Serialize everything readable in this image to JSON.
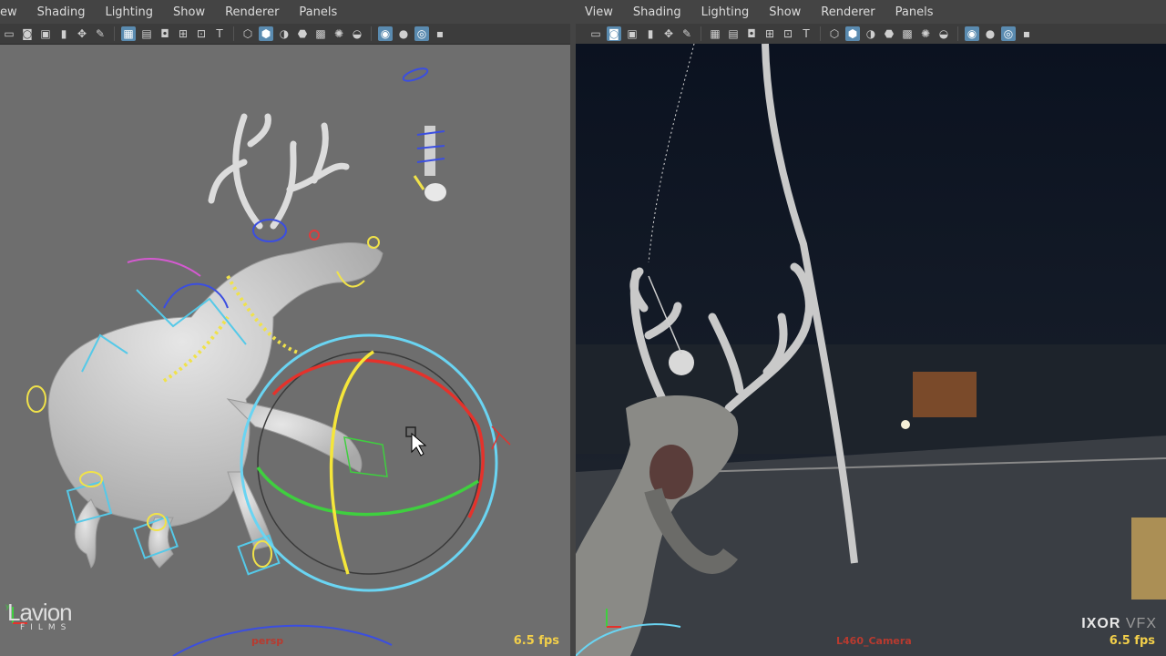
{
  "left_viewport": {
    "menu": [
      "ew",
      "Shading",
      "Lighting",
      "Show",
      "Renderer",
      "Panels"
    ],
    "camera": "persp",
    "fps": "6.5 fps",
    "logo_main": "Lavion",
    "logo_sub": "FILMS"
  },
  "right_viewport": {
    "menu": [
      "View",
      "Shading",
      "Lighting",
      "Show",
      "Renderer",
      "Panels"
    ],
    "camera": "L460_Camera",
    "fps": "6.5 fps",
    "watermark_a": "IXOR",
    "watermark_b": "VFX"
  },
  "toolbar_icons": [
    "select-camera-icon",
    "camera-attr-icon",
    "bookmark-icon",
    "image-plane-icon",
    "grid-icon",
    "film-gate-icon",
    "resolution-gate-icon",
    "safe-action-icon",
    "field-chart-icon",
    "wireframe-icon",
    "smooth-shade-icon",
    "textured-icon",
    "lights-icon",
    "shadows-icon",
    "xray-icon",
    "isolate-icon"
  ],
  "colors": {
    "gizmo_blue": "#6ad4f2",
    "gizmo_red": "#e5322b",
    "gizmo_green": "#3fcf3f",
    "gizmo_yellow": "#f5e63a",
    "fps": "#f2cf4a",
    "camera_label": "#b83a2f"
  }
}
